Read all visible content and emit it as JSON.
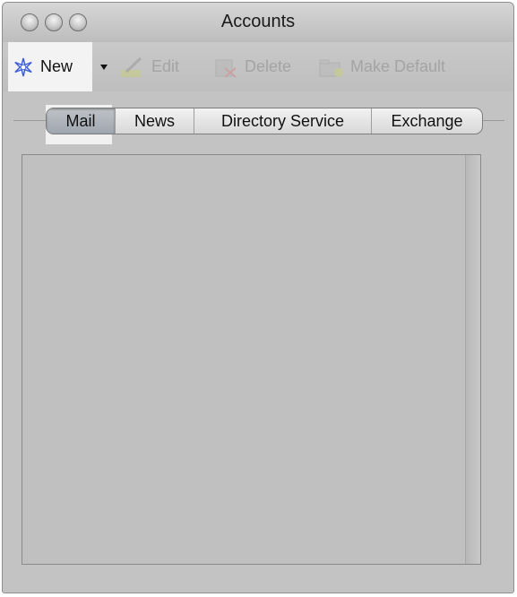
{
  "window": {
    "title": "Accounts"
  },
  "toolbar": {
    "new_label": "New",
    "new_icon": "new-account-star-icon",
    "dropdown_icon": "dropdown-triangle-icon",
    "edit_label": "Edit",
    "edit_icon": "pencil-icon",
    "delete_label": "Delete",
    "delete_icon": "delete-icon",
    "make_default_label": "Make Default",
    "make_default_icon": "folder-icon"
  },
  "tabs": [
    {
      "label": "Mail",
      "selected": true
    },
    {
      "label": "News",
      "selected": false
    },
    {
      "label": "Directory Service",
      "selected": false
    },
    {
      "label": "Exchange",
      "selected": false
    }
  ],
  "colors": {
    "window_bg": "#c3c3c3",
    "highlight": "#f3f3f3",
    "disabled_text": "#a4a4a4",
    "star_icon_blue": "#3f5fd8"
  }
}
